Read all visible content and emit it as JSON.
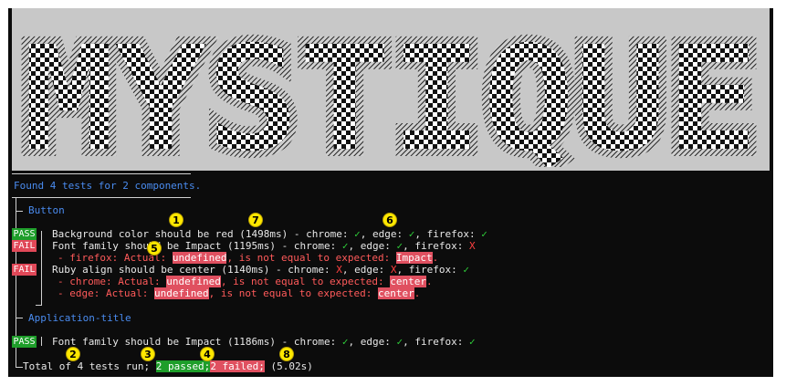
{
  "banner": {
    "title": "MYSTIQUE"
  },
  "summary_header": "Found 4 tests for 2 components.",
  "components": [
    {
      "name": "Button",
      "tests": [
        {
          "status": "PASS",
          "text": "Background color should be red (1498ms) - chrome: ",
          "chrome_mark": "✓",
          "edge_text": ", edge: ",
          "edge_mark": "✓",
          "firefox_text": ", firefox: ",
          "firefox_mark": "✓"
        },
        {
          "status": "FAIL",
          "text": "Font family should be Impact (1195ms) - chrome: ",
          "chrome_mark": "✓",
          "edge_text": ", edge: ",
          "edge_mark": "✓",
          "firefox_text": ", firefox: ",
          "firefox_mark": "X",
          "errors": [
            {
              "prefix": "- firefox: Actual: ",
              "actual": "undefined",
              "middle": ", is not equal to expected: ",
              "expected": "Impact",
              "suffix": "."
            }
          ]
        },
        {
          "status": "FAIL",
          "text": "Ruby align should be center (1140ms) - chrome: ",
          "chrome_mark": "X",
          "edge_text": ", edge: ",
          "edge_mark": "X",
          "firefox_text": ", firefox: ",
          "firefox_mark": "✓",
          "errors": [
            {
              "prefix": "- chrome: Actual: ",
              "actual": "undefined",
              "middle": ", is not equal to expected: ",
              "expected": "center",
              "suffix": "."
            },
            {
              "prefix": "- edge: Actual: ",
              "actual": "undefined",
              "middle": ", is not equal to expected: ",
              "expected": "center",
              "suffix": "."
            }
          ]
        }
      ]
    },
    {
      "name": "Application-title",
      "tests": [
        {
          "status": "PASS",
          "text": "Font family should be Impact (1186ms) - chrome: ",
          "chrome_mark": "✓",
          "edge_text": ", edge: ",
          "edge_mark": "✓",
          "firefox_text": ", firefox: ",
          "firefox_mark": "✓"
        }
      ]
    }
  ],
  "totals": {
    "prefix": "Total of 4 tests run; ",
    "passed": "2 passed;",
    "failed": "2 failed;",
    "duration": " (5.02s)"
  },
  "markers": [
    "1",
    "2",
    "3",
    "4",
    "5",
    "6",
    "7",
    "8"
  ],
  "colors": {
    "pass": "#1e9e2a",
    "fail": "#e04858",
    "marker": "#ffe800",
    "accent_blue": "#4a8cf0"
  }
}
